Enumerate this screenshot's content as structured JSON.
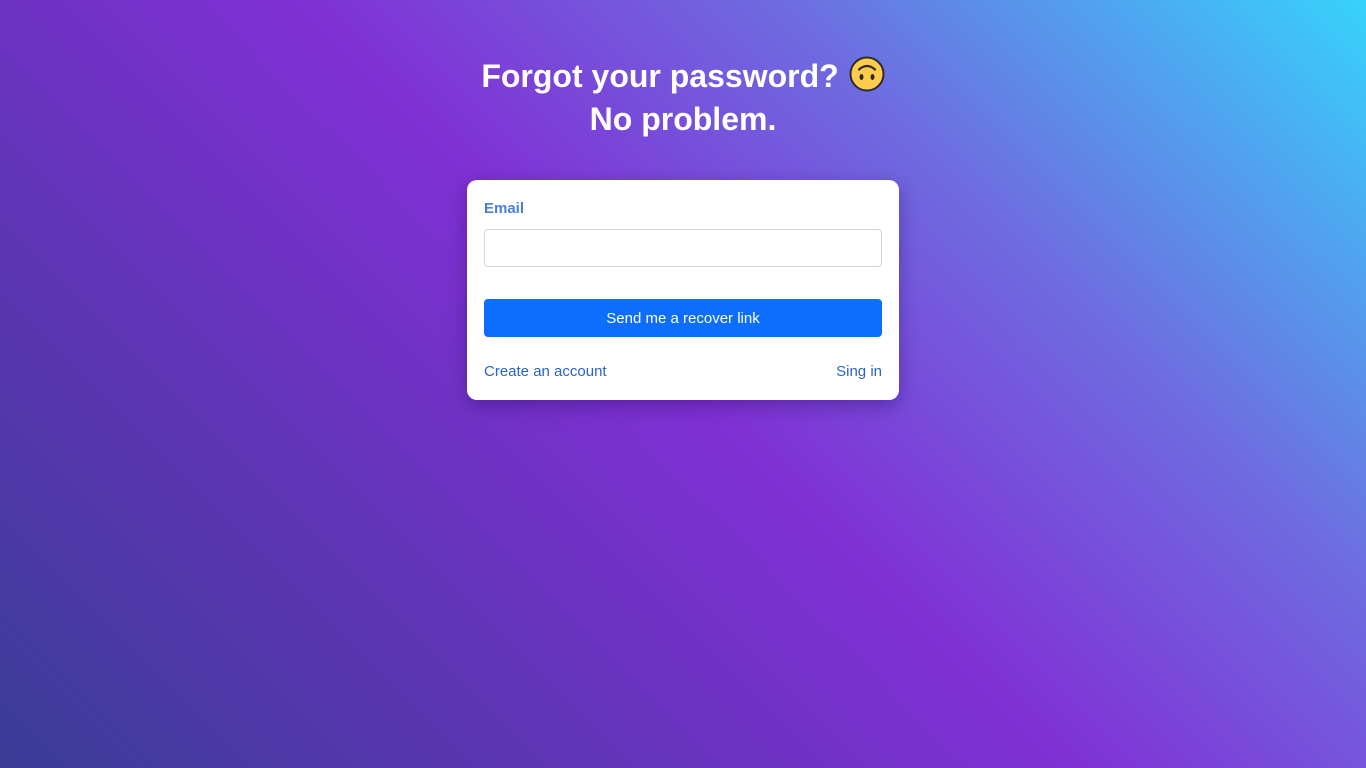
{
  "heading": {
    "line1": "Forgot your password?",
    "line2": "No problem.",
    "emoji_icon": "upside-down-face-icon"
  },
  "form": {
    "email_label": "Email",
    "email_value": "",
    "email_placeholder": "",
    "submit_label": "Send me a recover link"
  },
  "links": {
    "create_account": "Create an account",
    "sign_in": "Sing in"
  },
  "colors": {
    "primary_button": "#0d6efd",
    "link": "#2a64c9",
    "label": "#4a7fd6",
    "gradient_start": "#3a3d96",
    "gradient_mid": "#8030d4",
    "gradient_end": "#36d3fb"
  }
}
